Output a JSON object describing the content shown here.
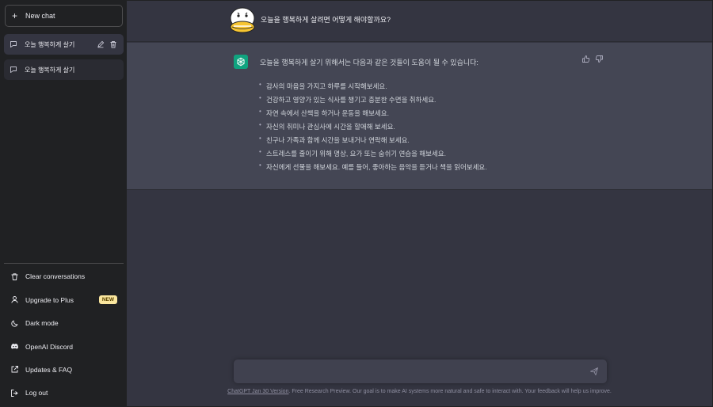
{
  "sidebar": {
    "new_chat_label": "New chat",
    "conversations": [
      {
        "title": "오늘 행복하게 살기",
        "active": true
      },
      {
        "title": "오늘 행복하게 살기",
        "active": false
      }
    ],
    "bottom_items": [
      {
        "label": "Clear conversations",
        "icon": "trash-icon"
      },
      {
        "label": "Upgrade to Plus",
        "icon": "user-icon",
        "badge": "NEW"
      },
      {
        "label": "Dark mode",
        "icon": "moon-icon"
      },
      {
        "label": "OpenAI Discord",
        "icon": "discord-icon"
      },
      {
        "label": "Updates & FAQ",
        "icon": "external-link-icon"
      },
      {
        "label": "Log out",
        "icon": "logout-icon"
      }
    ]
  },
  "chat": {
    "user_message": "오늘을 행복하게 살려면 어떻게 해야할까요?",
    "bot_intro": "오늘을 행복하게 살기 위해서는 다음과 같은 것들이 도움이 될 수 있습니다:",
    "bot_list": [
      "감사의 마음을 가지고 하루를 시작해보세요.",
      "건강하고 영양가 있는 식사를 챙기고 충분한 수면을 취하세요.",
      "자연 속에서 산책을 하거나 운동을 해보세요.",
      "자신의 취미나 관심사에 시간을 할애해 보세요.",
      "친구나 가족과 함께 시간을 보내거나 연락해 보세요.",
      "스트레스를 줄이기 위해 명상, 요가 또는 숨쉬기 연습을 해보세요.",
      "자신에게 선물을 해보세요. 예를 들어, 좋아하는 음악을 듣거나 책을 읽어보세요."
    ]
  },
  "composer": {
    "value": "",
    "placeholder": ""
  },
  "footer": {
    "version_link": "ChatGPT Jan 30 Version",
    "text": ". Free Research Preview. Our goal is to make AI systems more natural and safe to interact with. Your feedback will help us improve."
  },
  "colors": {
    "accent": "#10a37f",
    "sidebar": "#202123",
    "main": "#343541",
    "bot_row": "#444654",
    "badge": "#fae69e"
  }
}
